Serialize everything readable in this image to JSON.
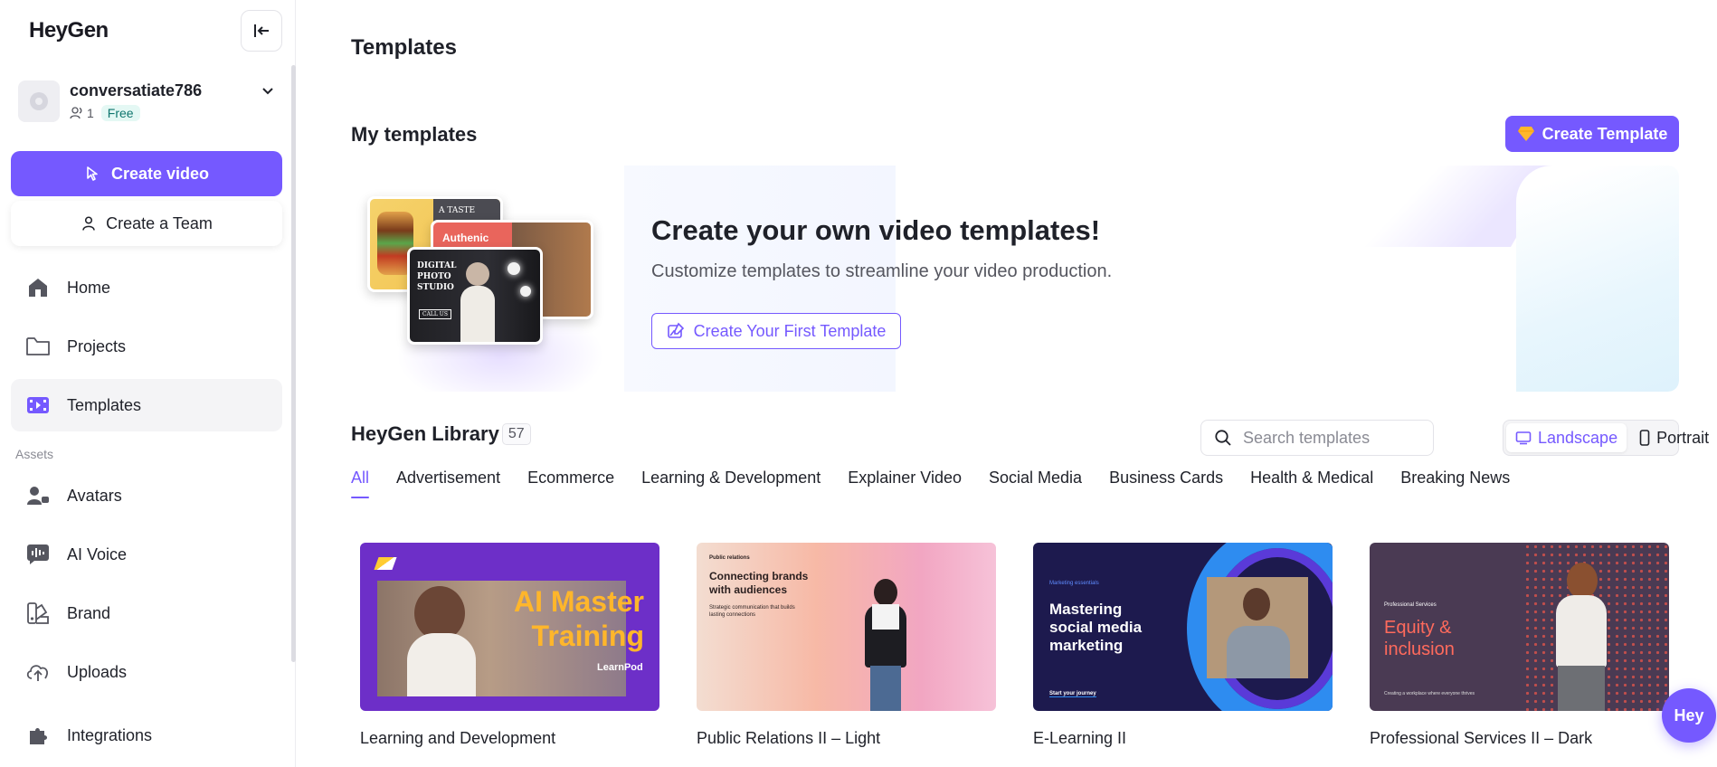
{
  "app": {
    "logo": "HeyGen"
  },
  "account": {
    "name": "conversatiate786",
    "members": "1",
    "plan": "Free"
  },
  "sidebar": {
    "create_video": "Create video",
    "create_team": "Create a Team",
    "items": [
      {
        "label": "Home",
        "icon": "home-icon"
      },
      {
        "label": "Projects",
        "icon": "folder-icon"
      },
      {
        "label": "Templates",
        "icon": "templates-icon",
        "active": true
      }
    ],
    "assets_label": "Assets",
    "assets": [
      {
        "label": "Avatars",
        "icon": "avatar-icon"
      },
      {
        "label": "AI Voice",
        "icon": "voice-icon"
      },
      {
        "label": "Brand",
        "icon": "brand-icon"
      },
      {
        "label": "Uploads",
        "icon": "upload-icon"
      },
      {
        "label": "Integrations",
        "icon": "puzzle-icon"
      }
    ]
  },
  "page": {
    "title": "Templates"
  },
  "my_templates": {
    "title": "My templates",
    "create_button": "Create Template",
    "banner_heading": "Create your own video templates!",
    "banner_sub": "Customize templates to streamline your video production.",
    "first_template_button": "Create Your First Template",
    "thumb_labels": {
      "taste": "A TASTE",
      "authentic": "Authenic",
      "studio": "DIGITAL PHOTO STUDIO",
      "call": "CALL US"
    }
  },
  "library": {
    "title": "HeyGen Library",
    "count": "57",
    "search_placeholder": "Search templates",
    "orientation": {
      "landscape": "Landscape",
      "portrait": "Portrait",
      "selected": "Landscape"
    },
    "tabs": [
      "All",
      "Advertisement",
      "Ecommerce",
      "Learning & Development",
      "Explainer Video",
      "Social Media",
      "Business Cards",
      "Health & Medical",
      "Breaking News"
    ],
    "active_tab": "All",
    "cards": [
      {
        "title": "Learning and Development",
        "thumb_main": "AI Master Training",
        "thumb_brand": "LearnPod"
      },
      {
        "title": "Public Relations II – Light",
        "thumb_kicker": "Public relations",
        "thumb_main": "Connecting brands with audiences",
        "thumb_sub": "Strategic communication that builds lasting connections"
      },
      {
        "title": "E-Learning II",
        "thumb_kicker": "Marketing essentials",
        "thumb_main": "Mastering social media marketing",
        "thumb_sub": "Start your journey"
      },
      {
        "title": "Professional Services II – Dark",
        "thumb_kicker": "Professional Services",
        "thumb_main": "Equity & inclusion",
        "thumb_sub": "Creating a workplace where everyone thrives"
      }
    ]
  },
  "fab": {
    "label": "Hey"
  },
  "colors": {
    "accent": "#7559ff",
    "free_badge": "#e4f8f4"
  }
}
